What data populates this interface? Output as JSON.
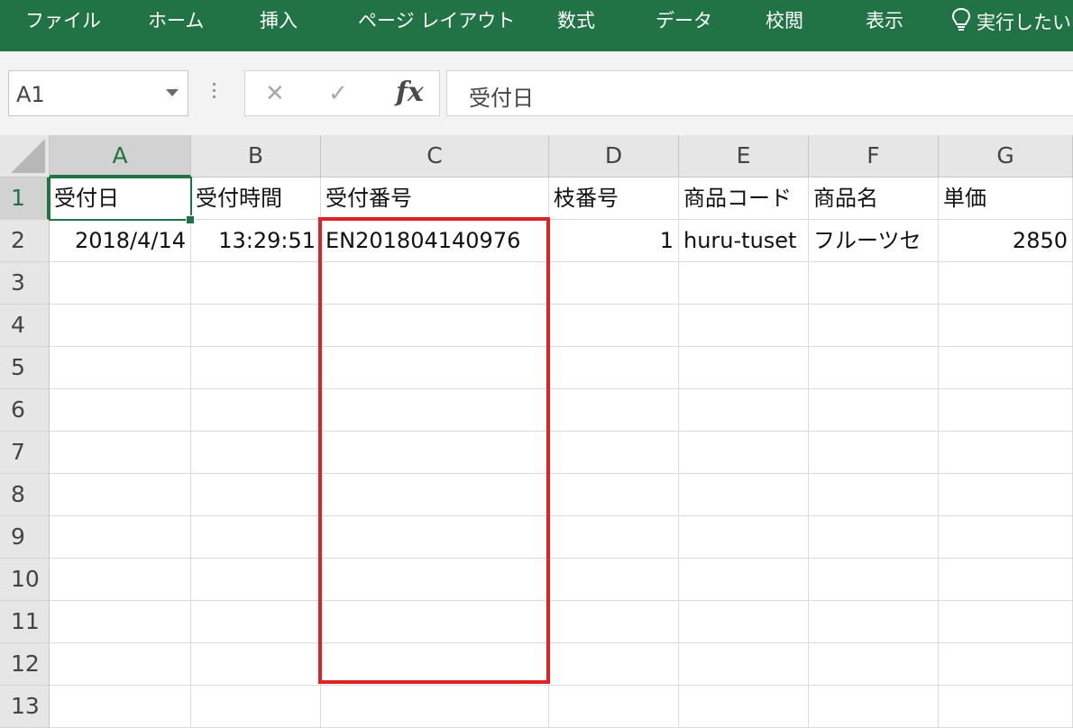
{
  "ribbon": {
    "tabs": [
      "ファイル",
      "ホーム",
      "挿入",
      "ページ レイアウト",
      "数式",
      "データ",
      "校閲",
      "表示"
    ],
    "tell_me": "実行したい",
    "tell_me_icon": "lightbulb-icon"
  },
  "formula_bar": {
    "name_box": "A1",
    "cancel_icon": "close-icon",
    "enter_icon": "check-icon",
    "fx_label": "fx",
    "content": "受付日"
  },
  "sheet": {
    "columns": [
      "A",
      "B",
      "C",
      "D",
      "E",
      "F",
      "G"
    ],
    "rows": [
      "1",
      "2",
      "3",
      "4",
      "5",
      "6",
      "7",
      "8",
      "9",
      "10",
      "11",
      "12",
      "13"
    ],
    "selected_cell": "A1",
    "highlight_color": "#e02127",
    "accent_color": "#217346",
    "data": [
      [
        "受付日",
        "受付時間",
        "受付番号",
        "枝番号",
        "商品コード",
        "商品名",
        "単価"
      ],
      [
        "2018/4/14",
        "13:29:51",
        "EN201804140976",
        "1",
        "huru-tuset",
        "フルーツセ",
        "2850"
      ]
    ]
  }
}
